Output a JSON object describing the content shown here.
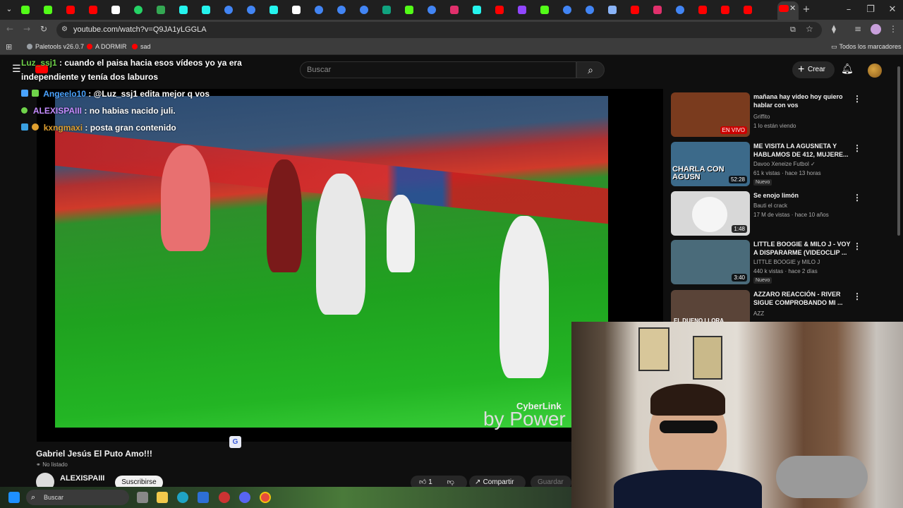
{
  "browser": {
    "url": "youtube.com/watch?v=Q9JA1yLGGLA",
    "bookmarks": [
      {
        "label": "Paletools v26.0.7",
        "color": "#9aa0a6"
      },
      {
        "label": "A DORMIR",
        "color": "#ff0000"
      },
      {
        "label": "sad",
        "color": "#ff0000"
      }
    ],
    "all_bookmarks_label": "Todos los marcadores",
    "tab_icons": [
      "kick-icon",
      "kick-icon",
      "youtube-icon",
      "youtube-icon",
      "x-icon",
      "whatsapp-icon",
      "extension-icon",
      "tiktok-icon",
      "tiktok-icon",
      "google-icon",
      "google-icon",
      "tiktok-icon",
      "x-icon",
      "google-icon",
      "google-icon",
      "google-icon",
      "chatgpt-icon",
      "kick-icon",
      "google-icon",
      "instagram-icon",
      "tiktok-icon",
      "youtube-icon",
      "twitch-icon",
      "kick-icon",
      "google-icon",
      "google-icon",
      "gemini-icon",
      "youtube-icon",
      "instagram-icon",
      "google-icon",
      "youtube-icon",
      "youtube-icon",
      "youtube-icon"
    ]
  },
  "youtube": {
    "search_placeholder": "Buscar",
    "create_label": "Crear",
    "video": {
      "title": "Gabriel Jesús El Puto Amo!!!",
      "visibility": "No listado",
      "channel": "ALEXISPAIII",
      "subscribe_label": "Suscribirse",
      "likes": "1",
      "share_label": "Compartir",
      "save_label": "Guardar",
      "watermark_top": "CyberLink",
      "watermark_bottom": "by Power"
    },
    "recommendations": [
      {
        "title": "mañana hay video hoy quiero hablar con vos",
        "channel": "Griffito",
        "meta": "1 lo están viendo",
        "badge": "EN VIVO",
        "badge_type": "live",
        "thumb_color": "#7a3b1e"
      },
      {
        "title": "ME VISITA LA AGUSNETA Y HABLAMOS DE 412, MUJERE...",
        "channel": "Davoo Xeneize Futbol",
        "meta": "61 k vistas · hace 13 horas",
        "badge": "52:28",
        "badge_type": "duration",
        "new_label": "Nuevo",
        "thumb_color": "#3c6a8a",
        "thumb_text": "CHARLA CON AGUSN"
      },
      {
        "title": "Se enojo limón",
        "channel": "Bauti el crack",
        "meta": "17 M de vistas · hace 10 años",
        "badge": "1:48",
        "badge_type": "duration",
        "thumb_color": "#d8d8d8"
      },
      {
        "title": "LITTLE BOOGIE & MILO J - VOY A DISPARARME (VIDEOCLIP ...",
        "channel": "LITTLE BOOGIE y MILO J",
        "meta": "440 k vistas · hace 2 días",
        "badge": "3:40",
        "badge_type": "duration",
        "new_label": "Nuevo",
        "thumb_color": "#4a6b7a"
      },
      {
        "title": "AZZARO REACCIÓN - RIVER SIGUE COMPROBANDO MI ...",
        "channel": "AZZ",
        "meta": "",
        "badge": "",
        "badge_type": "",
        "thumb_color": "#5a4438",
        "thumb_text": "EL DUENO LLORA"
      }
    ]
  },
  "chat": [
    {
      "user": "Luz_ssj1",
      "user_color": "#6fd34a",
      "text": ": cuando el paisa hacia esos vídeos yo ya era",
      "text2": "independiente y tenía dos laburos"
    },
    {
      "user": "Angeelo10",
      "user_color": "#4aa3ff",
      "text": ": @Luz_ssj1 edita mejor q vos"
    },
    {
      "user": "ALEXISPAIII",
      "user_color": "#c58cff",
      "text": ": no habias nacido juli."
    },
    {
      "user": "kxngmaxi",
      "user_color": "#e0a030",
      "text": ": posta gran contenido"
    }
  ],
  "taskbar": {
    "search_label": "Buscar"
  }
}
